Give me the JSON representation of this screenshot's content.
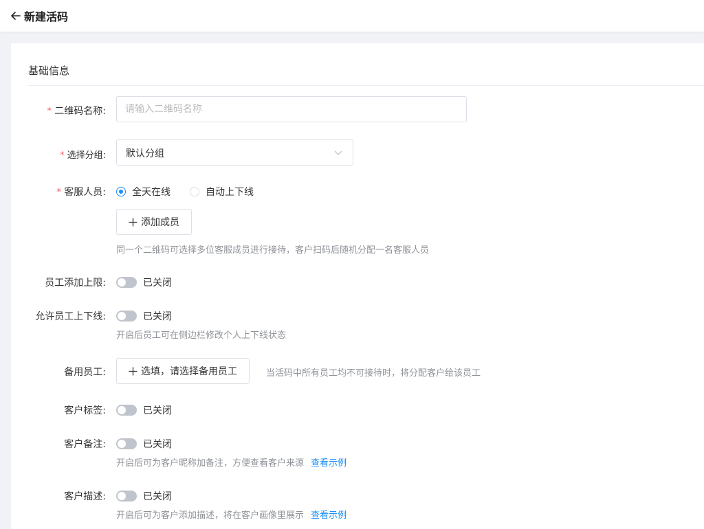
{
  "header": {
    "title": "新建活码"
  },
  "section": {
    "title": "基础信息"
  },
  "fields": {
    "qr_name": {
      "label": "二维码名称:",
      "placeholder": "请输入二维码名称",
      "value": ""
    },
    "group": {
      "label": "选择分组:",
      "value": "默认分组"
    },
    "service_staff": {
      "label": "客服人员:",
      "options": [
        "全天在线",
        "自动上下线"
      ],
      "selected": "全天在线",
      "add_button": "添加成员",
      "hint": "同一个二维码可选择多位客服成员进行接待，客户扫码后随机分配一名客服人员"
    },
    "staff_limit": {
      "label": "员工添加上限:",
      "state": "已关闭"
    },
    "allow_online": {
      "label": "允许员工上下线:",
      "state": "已关闭",
      "hint": "开启后员工可在侧边栏修改个人上下线状态"
    },
    "backup_staff": {
      "label": "备用员工:",
      "button": "选填，请选择备用员工",
      "hint": "当活码中所有员工均不可接待时，将分配客户给该员工"
    },
    "customer_tag": {
      "label": "客户标签:",
      "state": "已关闭"
    },
    "customer_remark": {
      "label": "客户备注:",
      "state": "已关闭",
      "hint": "开启后可为客户昵称加备注，方便查看客户来源",
      "link": "查看示例"
    },
    "customer_desc": {
      "label": "客户描述:",
      "state": "已关闭",
      "hint": "开启后可为客户添加描述，将在客户画像里展示",
      "link": "查看示例"
    }
  },
  "colors": {
    "accent": "#1890ff",
    "required": "#f56c6c",
    "switch_off": "#c0c4cc"
  }
}
